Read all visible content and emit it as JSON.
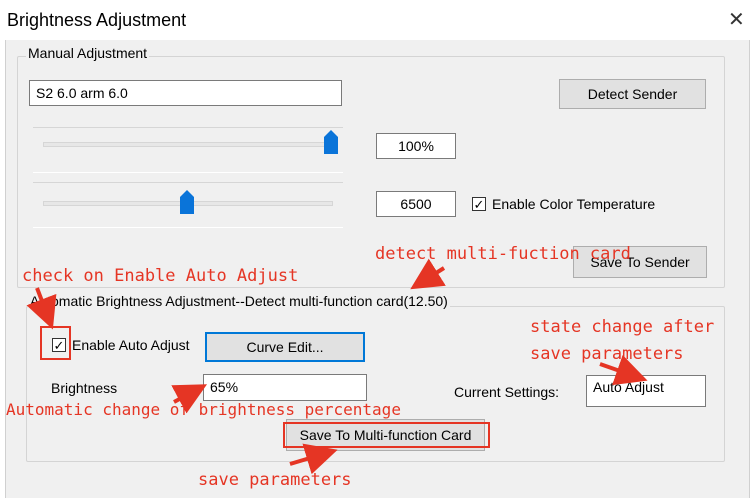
{
  "window": {
    "title": "Brightness Adjustment"
  },
  "manual": {
    "group_label": "Manual Adjustment",
    "sender_field_value": "S2 6.0 arm 6.0",
    "detect_button_label": "Detect Sender",
    "brightness_slider_value_percent": 100,
    "brightness_value": "100%",
    "color_temp_slider_fraction": 0.5,
    "color_temp_value": "6500",
    "enable_color_temp_label": "Enable Color Temperature",
    "enable_color_temp_checked": true,
    "save_to_sender_label": "Save To Sender"
  },
  "automatic": {
    "group_label": "Automatic Brightness Adjustment--Detect multi-function card(12.50)",
    "enable_auto_label": "Enable Auto Adjust",
    "enable_auto_checked": true,
    "curve_edit_label": "Curve Edit...",
    "brightness_label": "Brightness",
    "brightness_value": "65%",
    "current_settings_label": "Current Settings:",
    "current_settings_value": "Auto Adjust",
    "save_to_card_label": "Save To Multi-function Card"
  },
  "annotations": {
    "detect_card": "detect multi-fuction card",
    "check_on": "check on Enable Auto Adjust",
    "state_change_line1": "state change after",
    "state_change_line2": "save parameters",
    "auto_change": "Automatic change of brightness percentage",
    "save_params": "save parameters"
  },
  "colors": {
    "accent": "#0078d7",
    "annotation": "#e53524"
  }
}
